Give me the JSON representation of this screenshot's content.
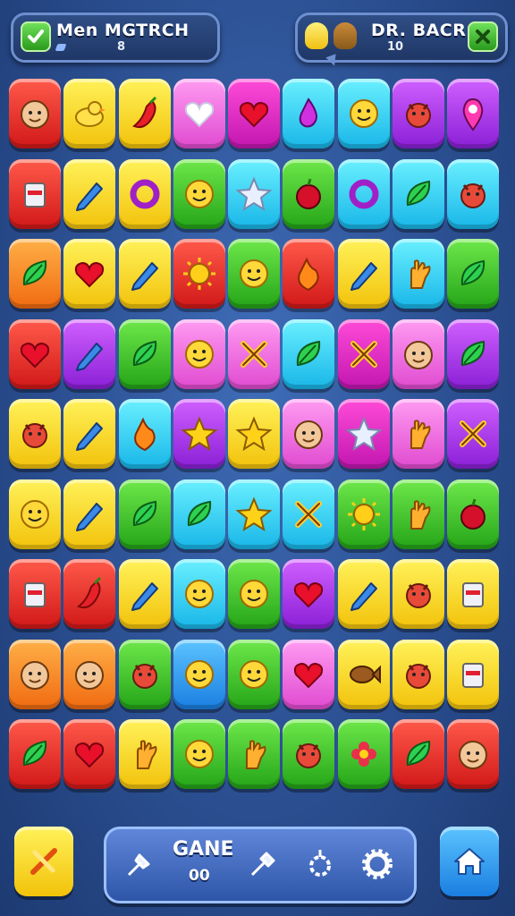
{
  "hud": {
    "left_title": "Men MGTRCH",
    "left_value": "8",
    "right_title": "DR. BACR",
    "right_value": "10"
  },
  "bottom_bar": {
    "title": "GANE",
    "value": "00"
  },
  "colors": {
    "background": "#2b4f91",
    "panel_border": "#6d8fd0",
    "accent_green": "#2a9a1d"
  },
  "board": {
    "rows": [
      [
        [
          "red",
          "face-icon"
        ],
        [
          "yellow",
          "duck-icon"
        ],
        [
          "yellow",
          "chili-icon"
        ],
        [
          "pink",
          "heart-outline-icon"
        ],
        [
          "magenta",
          "heart-icon"
        ],
        [
          "cyan",
          "drop-icon"
        ],
        [
          "cyan",
          "smiley-icon"
        ],
        [
          "purple",
          "creature-icon"
        ],
        [
          "purple",
          "pin-icon"
        ]
      ],
      [
        [
          "red",
          "cup-icon"
        ],
        [
          "yellow",
          "pencil-icon"
        ],
        [
          "yellow",
          "ring-icon"
        ],
        [
          "green",
          "smiley-icon"
        ],
        [
          "cyan",
          "star-outline-icon"
        ],
        [
          "green",
          "apple-icon"
        ],
        [
          "cyan",
          "ring-icon"
        ],
        [
          "cyan",
          "leaf-icon"
        ],
        [
          "cyan",
          "creature-icon"
        ]
      ],
      [
        [
          "orange",
          "leaf-icon"
        ],
        [
          "yellow",
          "heart-icon"
        ],
        [
          "yellow",
          "pencil-icon"
        ],
        [
          "red",
          "sun-icon"
        ],
        [
          "green",
          "smiley-icon"
        ],
        [
          "red",
          "flame-icon"
        ],
        [
          "yellow",
          "pencil-icon"
        ],
        [
          "cyan",
          "hand-icon"
        ],
        [
          "green",
          "leaf-icon"
        ]
      ],
      [
        [
          "red",
          "heart-icon"
        ],
        [
          "purple",
          "pencil-icon"
        ],
        [
          "green",
          "leaf-icon"
        ],
        [
          "pink",
          "smiley-icon"
        ],
        [
          "pink",
          "x-icon"
        ],
        [
          "cyan",
          "leaf-icon"
        ],
        [
          "magenta",
          "x-icon"
        ],
        [
          "pink",
          "face-icon"
        ],
        [
          "purple",
          "leaf-icon"
        ]
      ],
      [
        [
          "yellow",
          "creature-icon"
        ],
        [
          "yellow",
          "pencil-icon"
        ],
        [
          "cyan",
          "flame-icon"
        ],
        [
          "purple",
          "star-icon"
        ],
        [
          "yellow",
          "star-icon"
        ],
        [
          "pink",
          "face-icon"
        ],
        [
          "magenta",
          "star-outline-icon"
        ],
        [
          "pink",
          "hand-icon"
        ],
        [
          "purple",
          "x-icon"
        ]
      ],
      [
        [
          "yellow",
          "smiley-icon"
        ],
        [
          "yellow",
          "pencil-icon"
        ],
        [
          "green",
          "leaf-icon"
        ],
        [
          "cyan",
          "leaf-icon"
        ],
        [
          "cyan",
          "star-icon"
        ],
        [
          "cyan",
          "x-icon"
        ],
        [
          "green",
          "sun-icon"
        ],
        [
          "green",
          "hand-icon"
        ],
        [
          "green",
          "apple-icon"
        ]
      ],
      [
        [
          "red",
          "cup-icon"
        ],
        [
          "red",
          "chili-icon"
        ],
        [
          "yellow",
          "pencil-icon"
        ],
        [
          "cyan",
          "smiley-icon"
        ],
        [
          "green",
          "smiley-icon"
        ],
        [
          "purple",
          "heart-icon"
        ],
        [
          "yellow",
          "pencil-icon"
        ],
        [
          "yellow",
          "creature-icon"
        ],
        [
          "yellow",
          "cup-icon"
        ]
      ],
      [
        [
          "orange",
          "face-icon"
        ],
        [
          "orange",
          "face-icon"
        ],
        [
          "green",
          "creature-icon"
        ],
        [
          "blue",
          "smiley-icon"
        ],
        [
          "green",
          "smiley-icon"
        ],
        [
          "pink",
          "heart-icon"
        ],
        [
          "yellow",
          "fish-icon"
        ],
        [
          "yellow",
          "creature-icon"
        ],
        [
          "yellow",
          "cup-icon"
        ]
      ],
      [
        [
          "red",
          "leaf-icon"
        ],
        [
          "red",
          "heart-icon"
        ],
        [
          "yellow",
          "hand-icon"
        ],
        [
          "green",
          "smiley-icon"
        ],
        [
          "green",
          "hand-icon"
        ],
        [
          "green",
          "creature-icon"
        ],
        [
          "green",
          "flower-icon"
        ],
        [
          "red",
          "leaf-icon"
        ],
        [
          "red",
          "face-icon"
        ]
      ]
    ]
  }
}
